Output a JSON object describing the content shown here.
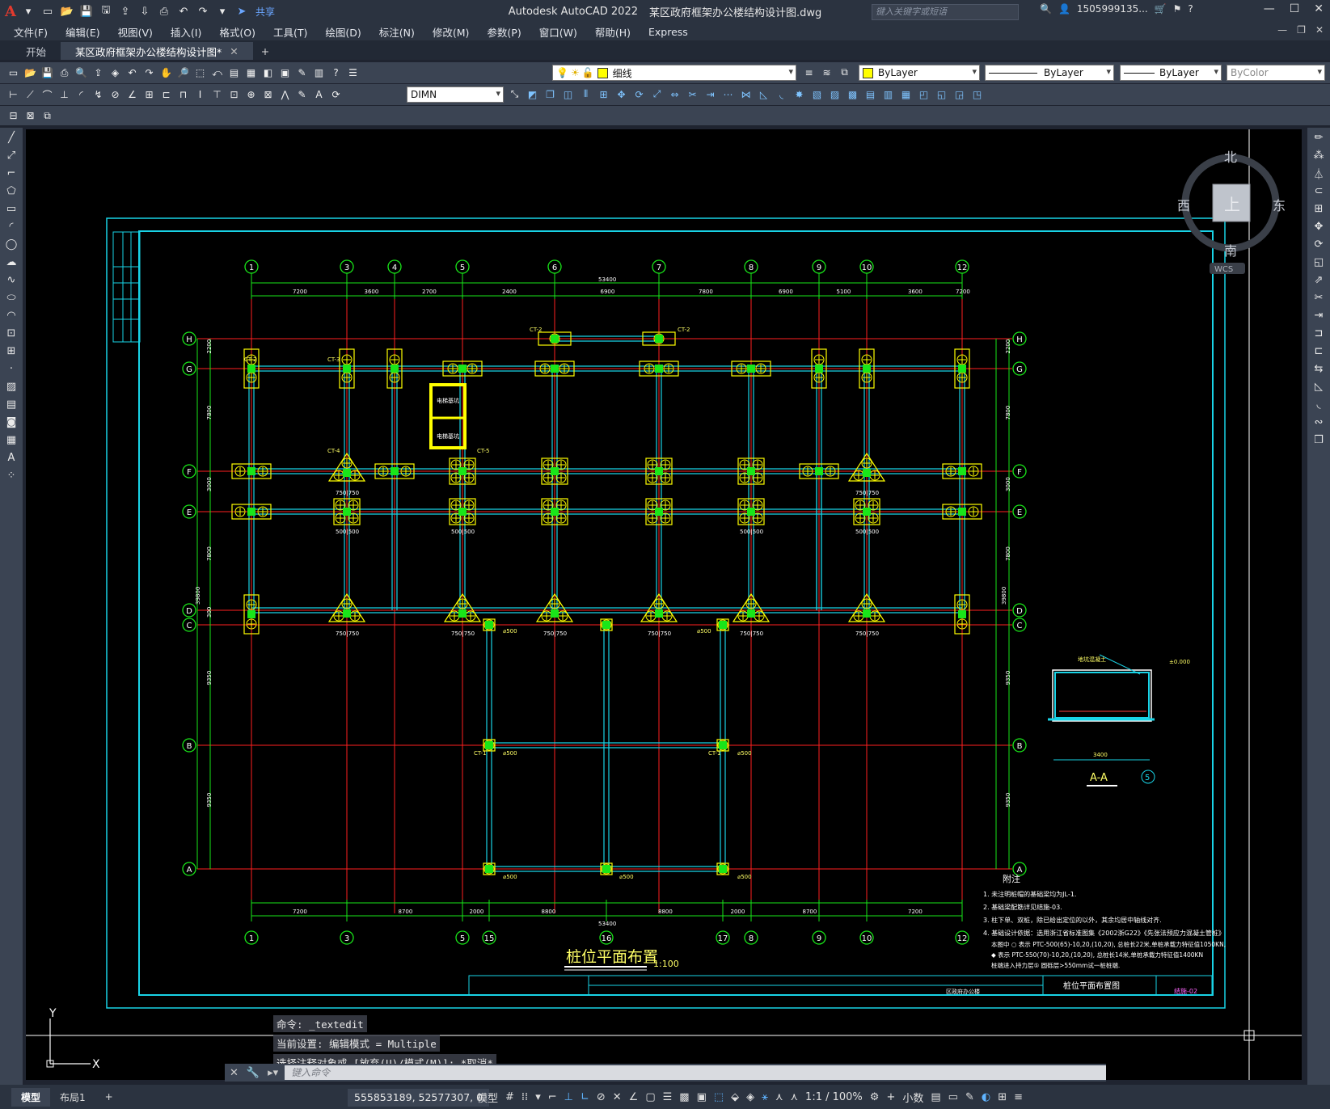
{
  "app": {
    "title": "Autodesk AutoCAD 2022",
    "file": "某区政府框架办公楼结构设计图.dwg",
    "share": "共享",
    "search_placeholder": "键入关键字或短语",
    "user": "1505999135..."
  },
  "menu": [
    "文件(F)",
    "编辑(E)",
    "视图(V)",
    "插入(I)",
    "格式(O)",
    "工具(T)",
    "绘图(D)",
    "标注(N)",
    "修改(M)",
    "参数(P)",
    "窗口(W)",
    "帮助(H)",
    "Express"
  ],
  "tabs": [
    {
      "label": "开始"
    },
    {
      "label": "某区政府框架办公楼结构设计图*"
    }
  ],
  "toolbar": {
    "layer": "细线",
    "color": "ByLayer",
    "linetype": "ByLayer",
    "lineweight": "ByLayer",
    "plotstyle": "ByColor",
    "dimstyle": "DIMN"
  },
  "viewcube": {
    "north": "北",
    "south": "南",
    "east": "东",
    "west": "西",
    "top": "上",
    "wcs": "WCS"
  },
  "drawing": {
    "grid_top": [
      "1",
      "3",
      "4",
      "5",
      "6",
      "7",
      "8",
      "9",
      "10",
      "12"
    ],
    "grid_bottom": [
      "1",
      "3",
      "5",
      "15",
      "16",
      "17",
      "8",
      "9",
      "10",
      "12"
    ],
    "grid_rows": [
      "H",
      "G",
      "F",
      "E",
      "D",
      "C",
      "B",
      "A"
    ],
    "top_dims": [
      "7200",
      "3600",
      "2700",
      "2400",
      "6900",
      "7800",
      "6900",
      "5100",
      "3600",
      "7200"
    ],
    "top_total": "53400",
    "bottom_dims": [
      "7200",
      "8700",
      "2000",
      "8800",
      "8800",
      "2000",
      "8700",
      "7200"
    ],
    "bottom_total": "53400",
    "left_dims": [
      "2200",
      "7800",
      "3000",
      "7800",
      "300",
      "9350",
      "9350"
    ],
    "right_dims": [
      "2200",
      "7800",
      "3000",
      "7800",
      "9350",
      "9350"
    ],
    "side_total": "39800",
    "title": "桩位平面布置",
    "scale": "1:100",
    "section_title": "A-A",
    "section_num": "5",
    "section_dim": "3400",
    "notes_title": "附注",
    "notes": [
      "1. 未注明桩帽的基础梁均为JL-1.",
      "2. 基础梁配筋详见结施-03.",
      "3. 柱下单、双桩，除已给出定位的以外，其余均居中轴线对齐.",
      "4. 基础设计依据：选用浙江省标准图集《2002浙G22》《先张法预应力混凝土管桩》",
      "本图中 ○ 表示 PTC-500(65)-10,20,(10,20), 总桩长22米,单桩承载力特征值1050KN,",
      "◆ 表示 PTC-550(70)-10,20,(10,20), 总桩长14米,单桩承载力特征值1400KN",
      "桩端进入持力层⑤ 圆砾层>550mm试一桩桩端."
    ],
    "title_block": {
      "drawing_name": "桩位平面布置图",
      "project": "区政府办公楼",
      "sheet": "结施-02"
    },
    "elevation": "±0.000",
    "labels": {
      "ct1": "CT-1",
      "ct2": "CT-2",
      "ct3": "CT-3",
      "ct4": "CT-4",
      "ct5": "CT-5",
      "d500": "⌀500",
      "cap_a": "750|750",
      "cap_b": "500|500",
      "elevator": "电梯基坑"
    }
  },
  "commands": [
    "命令: _textedit",
    "当前设置: 编辑模式 = Multiple",
    "选择注释对象或 [放弃(U)/模式(M)]: *取消*"
  ],
  "command_placeholder": "键入命令",
  "status": {
    "tabs": [
      "模型",
      "布局1"
    ],
    "coords": "555853189, 52577307, 0",
    "space": "模型",
    "scale": "1:1 / 100%",
    "units": "小数"
  }
}
